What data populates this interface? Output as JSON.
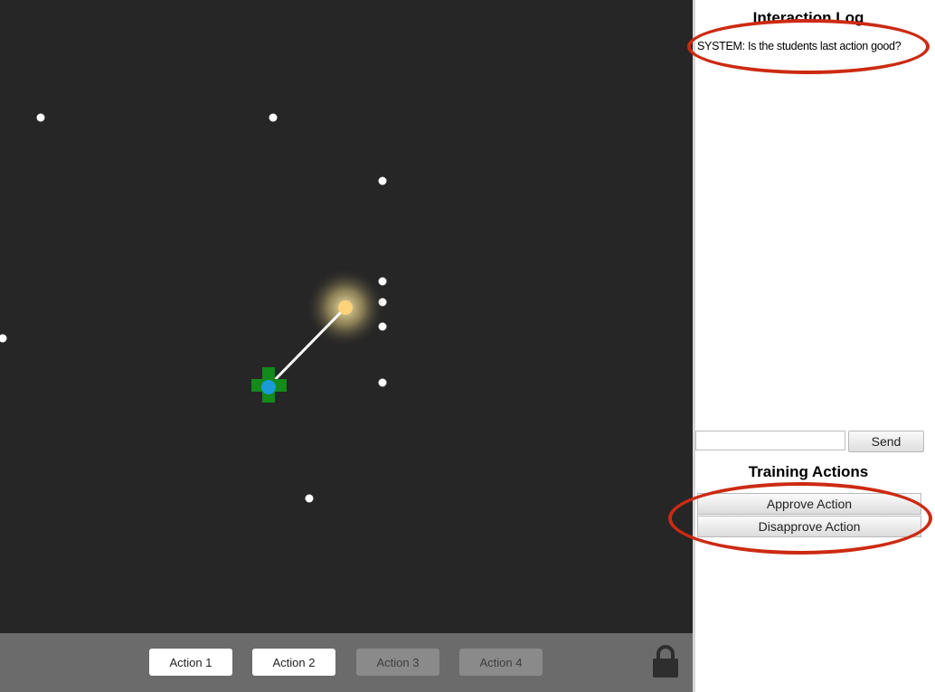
{
  "game": {
    "background": "#262626",
    "agent_color": "#1a9bd7",
    "cross_color": "#138a1a",
    "goal_color": "#ffd27a",
    "dot_color": "#ffffff"
  },
  "toolbar": {
    "actions": [
      {
        "label": "Action 1",
        "enabled": true
      },
      {
        "label": "Action 2",
        "enabled": true
      },
      {
        "label": "Action 3",
        "enabled": false
      },
      {
        "label": "Action 4",
        "enabled": false
      }
    ],
    "lock_icon": "padlock-icon"
  },
  "panel": {
    "log_title": "Interaction Log",
    "log_entries": [
      "SYSTEM: Is the students last action good?"
    ],
    "chat_placeholder": "",
    "send_label": "Send",
    "training_title": "Training Actions",
    "approve_label": "Approve Action",
    "disapprove_label": "Disapprove Action"
  },
  "annotation_color": "#cc2a12"
}
